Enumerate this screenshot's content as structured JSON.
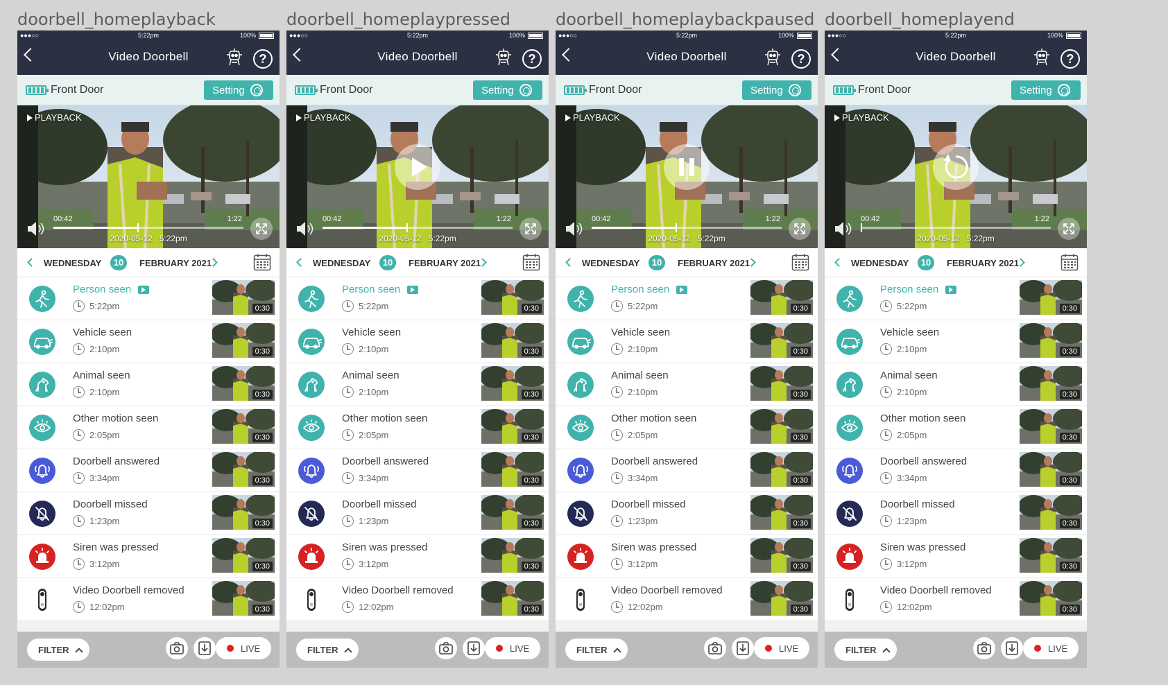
{
  "colors": {
    "header_bg": "#2b3142",
    "accent": "#3fb3ac",
    "device_bar_bg": "#e8f2f1",
    "live_dot": "#e02020"
  },
  "screens": [
    {
      "label": "doorbell_homeplayback",
      "overlay": "none",
      "overlay_icon": "none",
      "progress": 0.44
    },
    {
      "label": "doorbell_homeplaypressed",
      "overlay": "play",
      "overlay_icon": "play-icon",
      "progress": 0.44
    },
    {
      "label": "doorbell_homeplaybackpaused",
      "overlay": "pause",
      "overlay_icon": "pause-icon",
      "progress": 0.44
    },
    {
      "label": "doorbell_homeplayend",
      "overlay": "replay",
      "overlay_icon": "replay-icon",
      "progress": 0.0
    }
  ],
  "statusbar": {
    "signal": "●●●○○",
    "time": "5:22pm",
    "battery": "100%"
  },
  "header": {
    "title": "Video Doorbell",
    "help": "?"
  },
  "device": {
    "name": "Front Door",
    "setting_label": "Setting"
  },
  "video": {
    "playback_label": "PLAYBACK",
    "time_current": "00:42",
    "time_total": "1:22",
    "date": "2020-05-12",
    "time": "5:22pm"
  },
  "datebar": {
    "weekday": "WEDNESDAY",
    "day": "10",
    "month_year": "FEBRUARY 2021"
  },
  "events": [
    {
      "title": "Person seen",
      "time": "5:22pm",
      "duration": "0:30",
      "icon": "person-icon",
      "icon_bg": "#3fb3ac",
      "accent": true,
      "has_play_badge": true
    },
    {
      "title": "Vehicle seen",
      "time": "2:10pm",
      "duration": "0:30",
      "icon": "car-icon",
      "icon_bg": "#3fb3ac",
      "accent": false,
      "has_play_badge": false
    },
    {
      "title": "Animal seen",
      "time": "2:10pm",
      "duration": "0:30",
      "icon": "dog-icon",
      "icon_bg": "#3fb3ac",
      "accent": false,
      "has_play_badge": false
    },
    {
      "title": "Other motion seen",
      "time": "2:05pm",
      "duration": "0:30",
      "icon": "eye-icon",
      "icon_bg": "#3fb3ac",
      "accent": false,
      "has_play_badge": false
    },
    {
      "title": "Doorbell answered",
      "time": "3:34pm",
      "duration": "0:30",
      "icon": "bell-icon",
      "icon_bg": "#4a5bd8",
      "accent": false,
      "has_play_badge": false
    },
    {
      "title": "Doorbell missed",
      "time": "1:23pm",
      "duration": "0:30",
      "icon": "bell-off-icon",
      "icon_bg": "#242a55",
      "accent": false,
      "has_play_badge": false
    },
    {
      "title": "Siren was pressed",
      "time": "3:12pm",
      "duration": "0:30",
      "icon": "siren-icon",
      "icon_bg": "#d62222",
      "accent": false,
      "has_play_badge": false
    },
    {
      "title": "Video Doorbell removed",
      "time": "12:02pm",
      "duration": "0:30",
      "icon": "doorbell-device-icon",
      "icon_bg": "#ffffff",
      "accent": false,
      "has_play_badge": false
    }
  ],
  "footer": {
    "filter_label": "FILTER",
    "live_label": "LIVE"
  }
}
